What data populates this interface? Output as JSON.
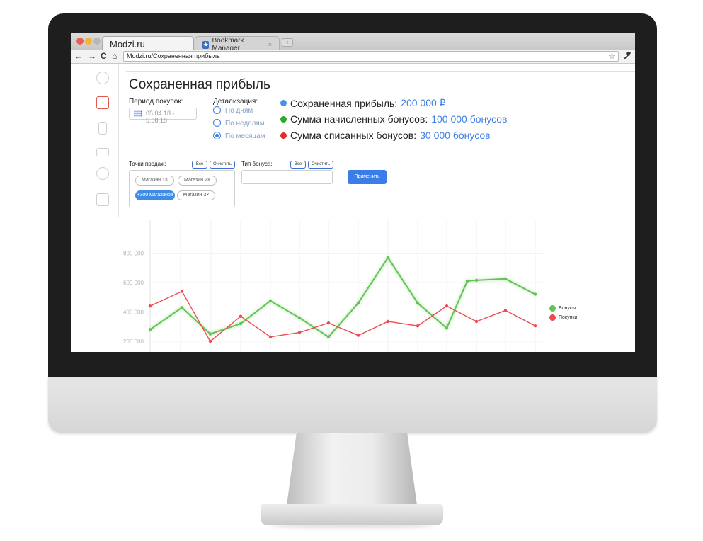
{
  "browser": {
    "active_tab": "Modzi.ru",
    "inactive_tab": "Bookmark Manager",
    "inactive_tab_icon": "star-icon",
    "tab_close": "×",
    "newtab": "+",
    "back": "←",
    "forward": "→",
    "reload": "C",
    "home": "⌂",
    "url": "Modzi.ru/Сохраненная прибыль",
    "bookmark_star": "☆",
    "settings": "🔧"
  },
  "page": {
    "title": "Сохраненная прибыль",
    "period_label": "Период покупок:",
    "date_range": "05.04.18 - 5.08.18",
    "detail_label": "Детализация:",
    "detail_options": [
      "По дням",
      "По неделям",
      "По месяцам"
    ],
    "detail_selected": "По месяцам",
    "stats": [
      {
        "label": "Сохраненная прибыль:",
        "value": "200 000 ₽",
        "color": "#4a90e2"
      },
      {
        "label": "Сумма начисленных бонусов:",
        "value": "100 000 бонусов",
        "color": "#2ea82e"
      },
      {
        "label": "Сумма списанных бонусов:",
        "value": "30 000 бонусов",
        "color": "#d9302c"
      }
    ],
    "points_label": "Точки продаж:",
    "all_btn": "Все",
    "clear_btn": "Очистить",
    "chips": [
      "Магазин 1×",
      "Магазин 2×",
      "+300 магазинов",
      "Магазин 3×"
    ],
    "bonus_type_label": "Тип бонуса:",
    "apply_btn": "Применить"
  },
  "sidebar_icons": [
    "gears-icon",
    "report-icon",
    "phone-icon",
    "mail-icon",
    "settings-icon",
    "play-icon"
  ],
  "chart_data": {
    "type": "line",
    "y_ticks": [
      "200 000",
      "400 000",
      "600 000",
      "800 000"
    ],
    "ylim": [
      160000,
      900000
    ],
    "series": [
      {
        "name": "Бонусы",
        "color": "#62c454",
        "values": [
          280000,
          430000,
          250000,
          320000,
          475000,
          360000,
          230000,
          460000,
          770000,
          460000,
          290000,
          610000,
          615000,
          625000,
          520000
        ]
      },
      {
        "name": "Покупки",
        "color": "#f04a4e",
        "values": [
          440000,
          540000,
          200000,
          370000,
          230000,
          260000,
          325000,
          240000,
          335000,
          305000,
          440000,
          335000,
          410000,
          305000
        ]
      }
    ]
  }
}
